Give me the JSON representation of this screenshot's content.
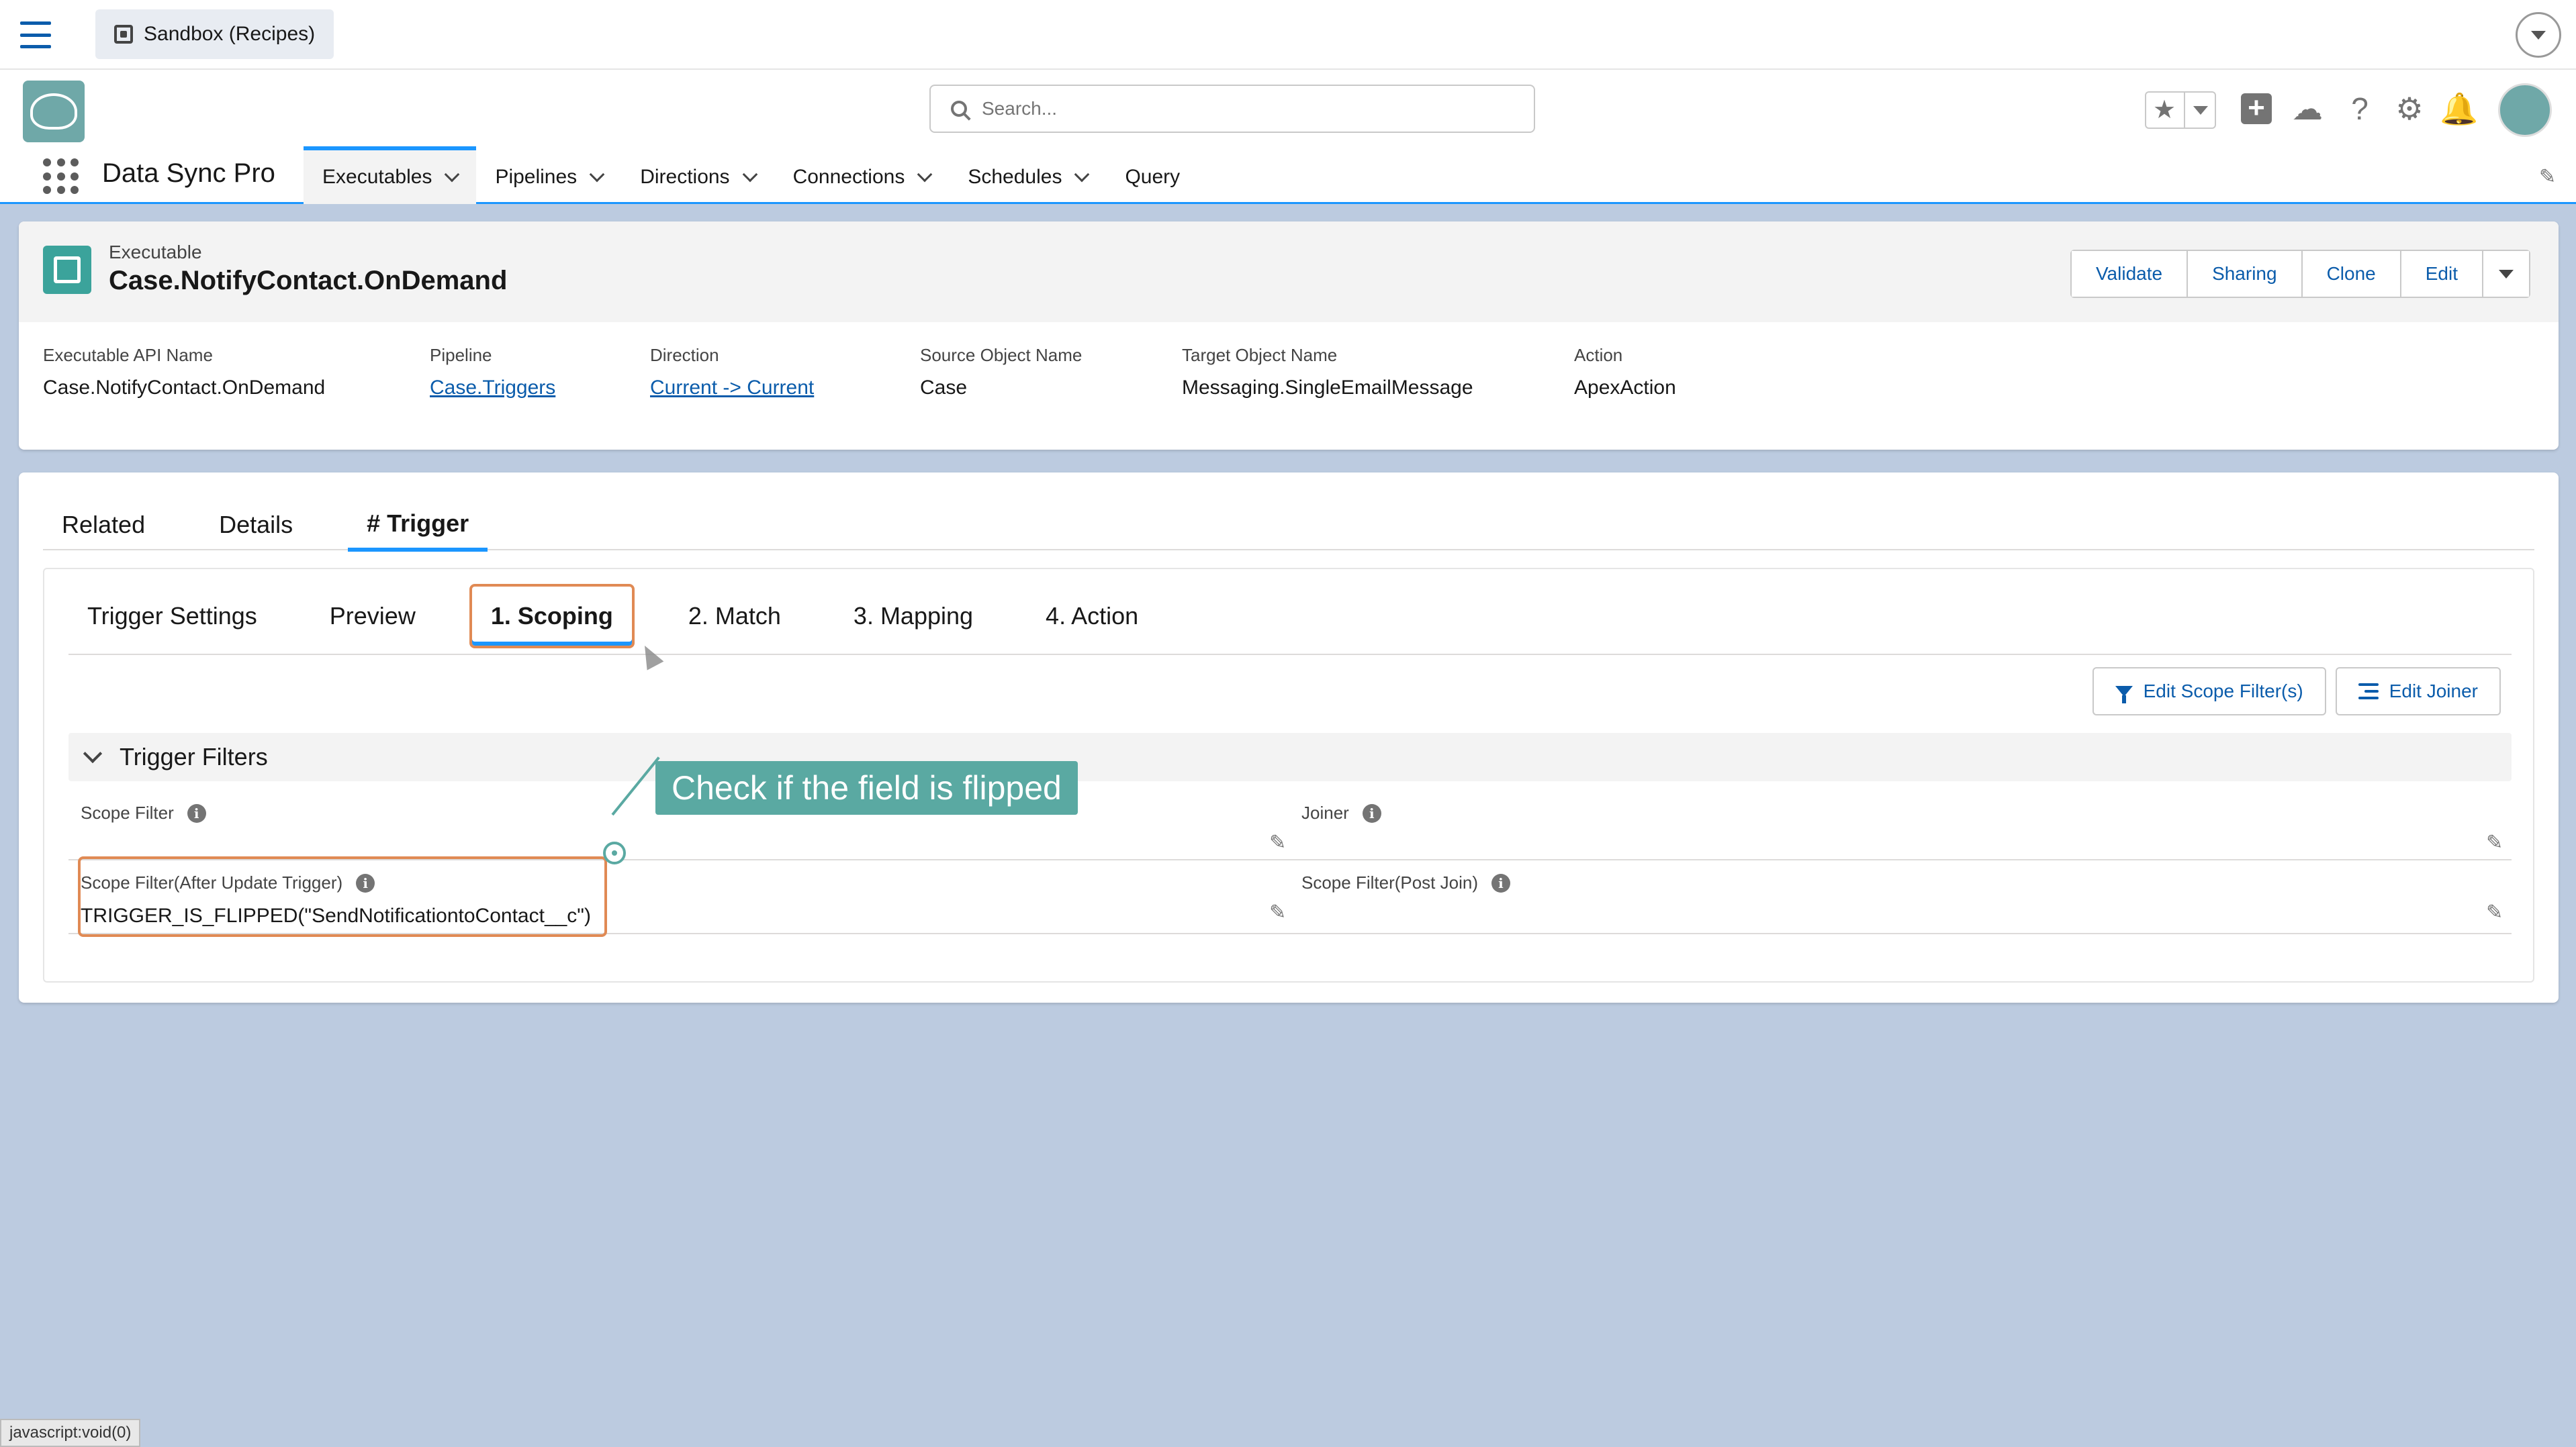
{
  "topbar": {
    "sandbox_label": "Sandbox (Recipes)"
  },
  "header": {
    "search_placeholder": "Search...",
    "app_name": "Data Sync Pro",
    "nav": [
      {
        "label": "Executables",
        "active": true,
        "has_menu": true
      },
      {
        "label": "Pipelines",
        "has_menu": true
      },
      {
        "label": "Directions",
        "has_menu": true
      },
      {
        "label": "Connections",
        "has_menu": true
      },
      {
        "label": "Schedules",
        "has_menu": true
      },
      {
        "label": "Query",
        "has_menu": false
      }
    ]
  },
  "record": {
    "type_label": "Executable",
    "title": "Case.NotifyContact.OnDemand",
    "actions": [
      "Validate",
      "Sharing",
      "Clone",
      "Edit"
    ],
    "fields": [
      {
        "label": "Executable API Name",
        "value": "Case.NotifyContact.OnDemand",
        "link": false
      },
      {
        "label": "Pipeline",
        "value": "Case.Triggers",
        "link": true
      },
      {
        "label": "Direction",
        "value": "Current -> Current",
        "link": true
      },
      {
        "label": "Source Object Name",
        "value": "Case",
        "link": false
      },
      {
        "label": "Target Object Name",
        "value": "Messaging.SingleEmailMessage",
        "link": false
      },
      {
        "label": "Action",
        "value": "ApexAction",
        "link": false
      }
    ]
  },
  "tabs": [
    "Related",
    "Details",
    "# Trigger"
  ],
  "subtabs": [
    "Trigger Settings",
    "Preview",
    "1. Scoping",
    "2. Match",
    "3. Mapping",
    "4. Action"
  ],
  "scope_buttons": {
    "edit_scope": "Edit Scope Filter(s)",
    "edit_joiner": "Edit Joiner"
  },
  "section": {
    "title": "Trigger Filters",
    "fields": {
      "scope_filter": {
        "label": "Scope Filter",
        "value": ""
      },
      "joiner": {
        "label": "Joiner",
        "value": ""
      },
      "scope_after_update": {
        "label": "Scope Filter(After Update Trigger)",
        "value": "TRIGGER_IS_FLIPPED(\"SendNotificationtoContact__c\")"
      },
      "scope_post_join": {
        "label": "Scope Filter(Post Join)",
        "value": ""
      }
    }
  },
  "callout": "Check if the field is flipped",
  "status_bar": "javascript:void(0)",
  "colors": {
    "brand_blue": "#1b96ff",
    "link_blue": "#0b5cab",
    "highlight_orange": "#e08a54",
    "callout_teal": "#5aa9a2",
    "page_bg": "#bccbe0"
  }
}
